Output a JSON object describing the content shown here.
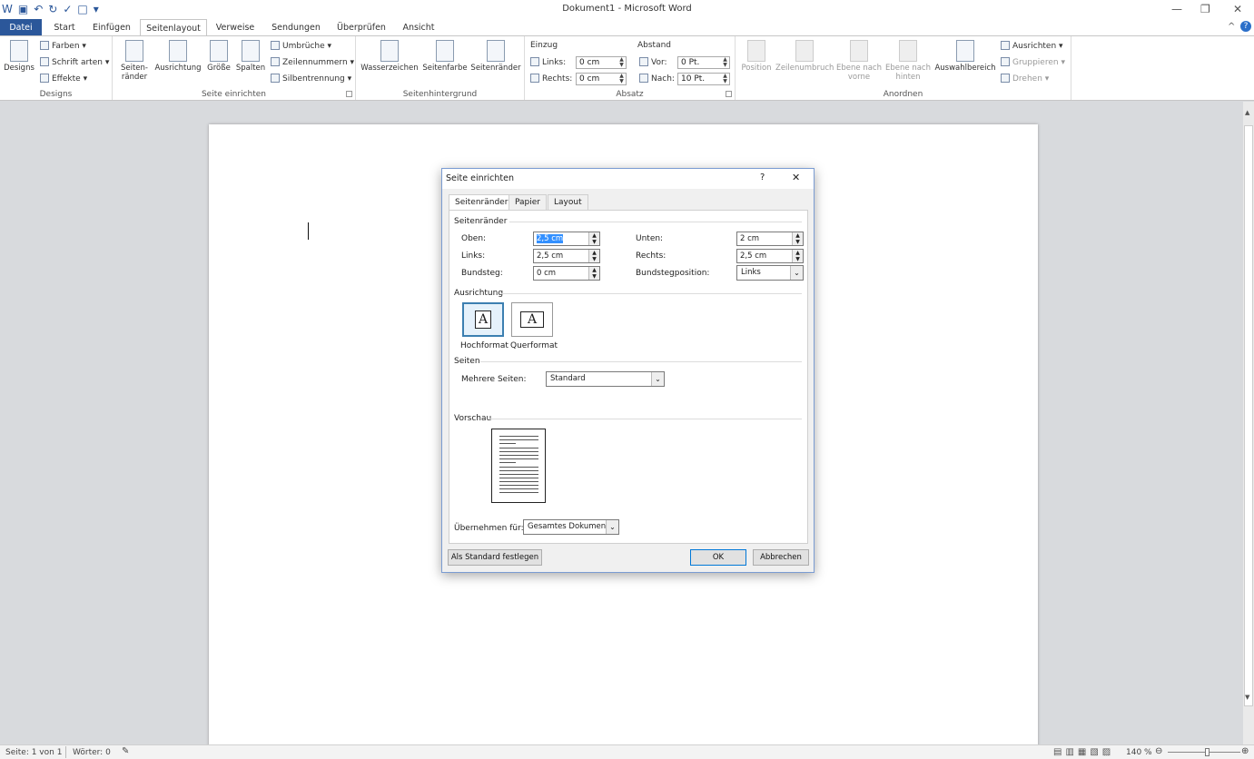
{
  "window": {
    "title": "Dokument1 - Microsoft Word"
  },
  "tabs": [
    "Datei",
    "Start",
    "Einfügen",
    "Seitenlayout",
    "Verweise",
    "Sendungen",
    "Überprüfen",
    "Ansicht"
  ],
  "ribbon": {
    "designs": {
      "designs": "Designs",
      "farben": "Farben",
      "schriftarten": "Schrift arten",
      "effekte": "Effekte",
      "group": "Designs"
    },
    "seite_einrichten": {
      "seitenraender_1": "Seiten-",
      "seitenraender_2": "ränder",
      "ausrichtung": "Ausrichtung",
      "groesse": "Größe",
      "spalten": "Spalten",
      "umbrueche": "Umbrüche",
      "zeilennummern": "Zeilennummern",
      "silbentrennung": "Silbentrennung",
      "group": "Seite einrichten"
    },
    "seitenhintergrund": {
      "wasserzeichen": "Wasserzeichen",
      "seitenfarbe": "Seitenfarbe",
      "seitenraender": "Seitenränder",
      "group": "Seitenhintergrund"
    },
    "absatz": {
      "einzug": "Einzug",
      "abstand": "Abstand",
      "links": "Links:",
      "links_val": "0 cm",
      "rechts": "Rechts:",
      "rechts_val": "0 cm",
      "vor": "Vor:",
      "vor_val": "0 Pt.",
      "nach": "Nach:",
      "nach_val": "10 Pt.",
      "group": "Absatz"
    },
    "anordnen": {
      "position": "Position",
      "zeilenumbruch": "Zeilenumbruch",
      "ebene_vorne_1": "Ebene nach",
      "ebene_vorne_2": "vorne",
      "ebene_hinten_1": "Ebene nach",
      "ebene_hinten_2": "hinten",
      "auswahlbereich": "Auswahlbereich",
      "ausrichten": "Ausrichten",
      "gruppieren": "Gruppieren",
      "drehen": "Drehen",
      "group": "Anordnen"
    }
  },
  "dialog": {
    "title": "Seite einrichten",
    "help": "?",
    "close": "✕",
    "tabs": [
      "Seitenränder",
      "Papier",
      "Layout"
    ],
    "margins": {
      "section": "Seitenränder",
      "oben": "Oben:",
      "oben_val": "2,5 cm",
      "unten": "Unten:",
      "unten_val": "2 cm",
      "links": "Links:",
      "links_val": "2,5 cm",
      "rechts": "Rechts:",
      "rechts_val": "2,5 cm",
      "bundsteg": "Bundsteg:",
      "bundsteg_val": "0 cm",
      "bundstegposition": "Bundstegposition:",
      "bundstegposition_val": "Links"
    },
    "orientation": {
      "section": "Ausrichtung",
      "hochformat": "Hochformat",
      "querformat": "Querformat",
      "glyph": "A"
    },
    "pages": {
      "section": "Seiten",
      "mehrere": "Mehrere Seiten:",
      "mehrere_val": "Standard"
    },
    "preview": {
      "section": "Vorschau"
    },
    "apply": {
      "label": "Übernehmen für:",
      "value": "Gesamtes Dokument"
    },
    "buttons": {
      "default": "Als Standard festlegen",
      "ok": "OK",
      "cancel": "Abbrechen"
    }
  },
  "status": {
    "page": "Seite: 1 von 1",
    "words": "Wörter: 0",
    "zoom": "140 %"
  }
}
